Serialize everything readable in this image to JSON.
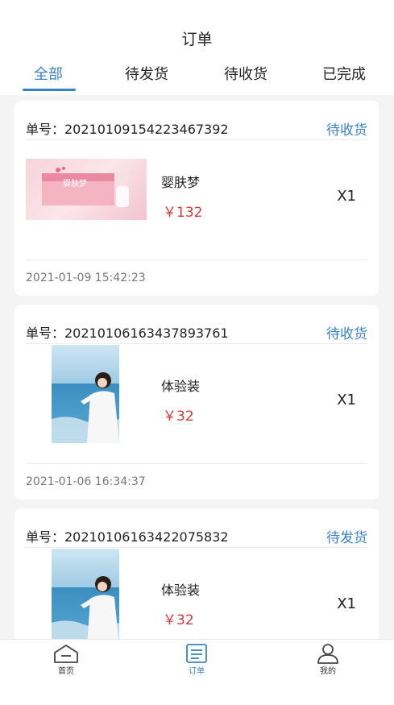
{
  "header": {
    "title": "订单"
  },
  "tabs": [
    {
      "label": "全部",
      "active": true
    },
    {
      "label": "待发货",
      "active": false
    },
    {
      "label": "待收货",
      "active": false
    },
    {
      "label": "已完成",
      "active": false
    }
  ],
  "orders": [
    {
      "number_label": "单号：20210109154223467392",
      "status": "待收货",
      "product_name": "婴肤梦",
      "price": "￥132",
      "quantity": "X1",
      "time": "2021-01-09 15:42:23",
      "thumb_text": "婴肤梦"
    },
    {
      "number_label": "单号：20210106163437893761",
      "status": "待收货",
      "product_name": "体验装",
      "price": "￥32",
      "quantity": "X1",
      "time": "2021-01-06 16:34:37"
    },
    {
      "number_label": "单号：20210106163422075832",
      "status": "待发货",
      "product_name": "体验装",
      "price": "￥32",
      "quantity": "X1"
    }
  ],
  "bottom_nav": [
    {
      "label": "首页",
      "icon": "home-icon",
      "active": false
    },
    {
      "label": "订单",
      "icon": "order-icon",
      "active": true
    },
    {
      "label": "我的",
      "icon": "profile-icon",
      "active": false
    }
  ],
  "colors": {
    "accent": "#3b82c4",
    "price": "#d13a3a",
    "background": "#f4f4f4"
  }
}
